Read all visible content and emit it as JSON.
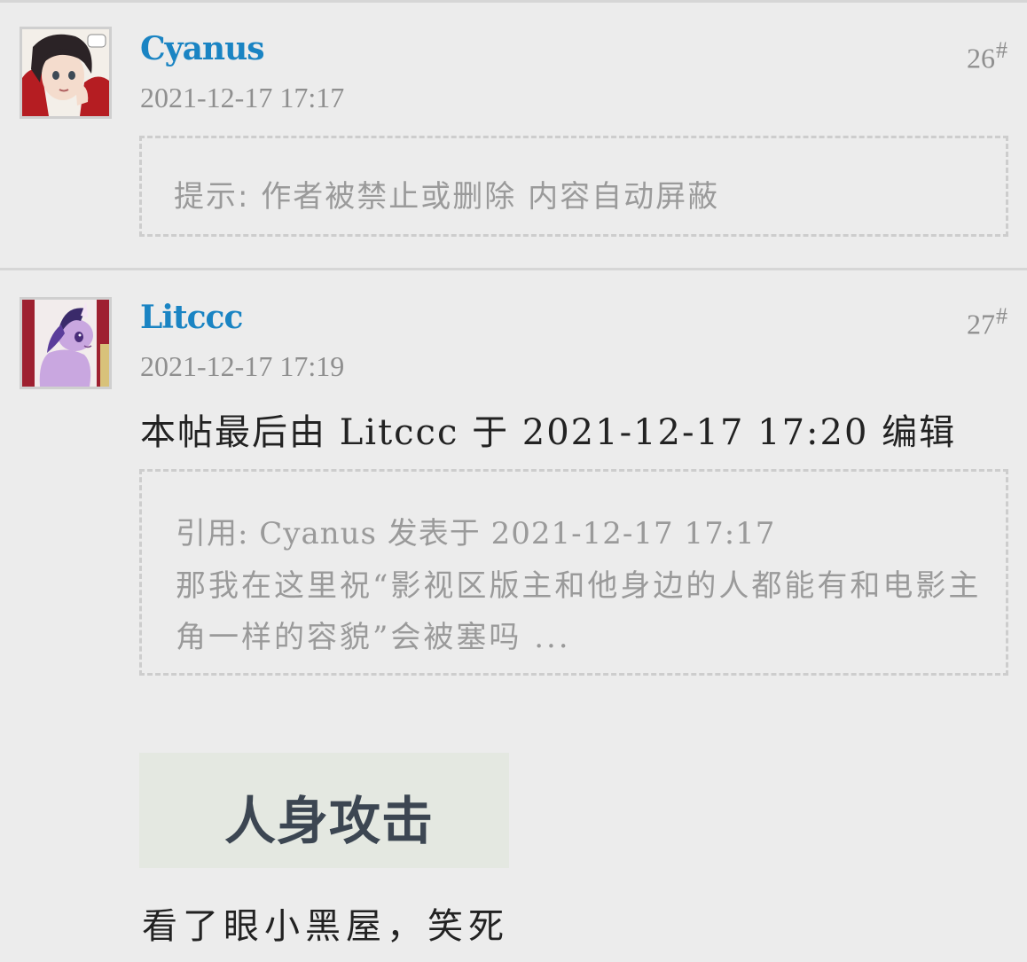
{
  "posts": [
    {
      "username": "Cyanus",
      "timestamp": "2021-12-17 17:17",
      "floor_number": "26",
      "floor_suffix": "#",
      "notice": "提示: 作者被禁止或删除 内容自动屏蔽"
    },
    {
      "username": "Litccc",
      "timestamp": "2021-12-17 17:19",
      "floor_number": "27",
      "floor_suffix": "#",
      "edit_note": "本帖最后由 Litccc 于 2021-12-17 17:20 编辑",
      "quote_header": "引用: Cyanus 发表于 2021-12-17 17:17",
      "quote_body": "那我在这里祝“影视区版主和他身边的人都能有和电影主角一样的容貌”会被塞吗 ...",
      "sticker_text": "人身攻击",
      "reply_text": "看了眼小黑屋，笑死"
    }
  ],
  "colors": {
    "background": "#ececec",
    "username": "#1a84c3",
    "muted_text": "#8f8f8f",
    "border": "#cdcdcd"
  }
}
